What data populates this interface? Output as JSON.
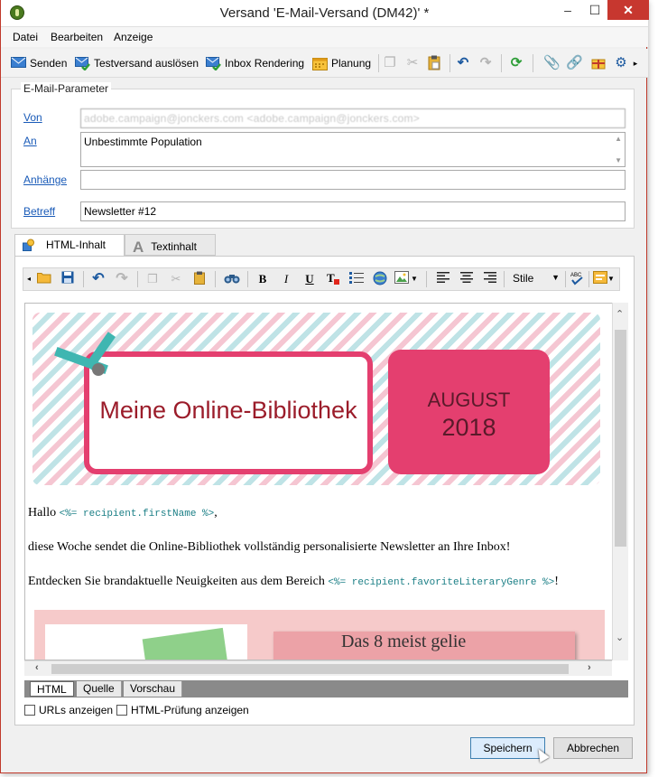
{
  "window": {
    "title": "Versand 'E-Mail-Versand (DM42)' *",
    "min": "–",
    "max": "☐",
    "close": "✕"
  },
  "menu": [
    "Datei",
    "Bearbeiten",
    "Anzeige"
  ],
  "toolbar": {
    "send": "Senden",
    "test_send": "Testversand auslösen",
    "inbox_rendering": "Inbox Rendering",
    "planning": "Planung"
  },
  "params": {
    "legend": "E-Mail-Parameter",
    "from_label": "Von",
    "from_value": "adobe.campaign@jonckers.com <adobe.campaign@jonckers.com>",
    "to_label": "An",
    "to_value": "Unbestimmte Population",
    "attachments_label": "Anhänge",
    "attachments_value": "",
    "subject_label": "Betreff",
    "subject_value": "Newsletter #12"
  },
  "tabs": {
    "html": "HTML-Inhalt",
    "text": "Textinhalt"
  },
  "editor": {
    "styles_label": "Stile",
    "bold": "B",
    "italic": "I",
    "underline": "U"
  },
  "newsletter": {
    "banner_title": "Meine Online-Bibliothek",
    "month": "AUGUST",
    "year": "2018",
    "greeting_prefix": "Hallo ",
    "greeting_code": "<%= recipient.firstName %>",
    "greeting_suffix": ",",
    "line2": "diese Woche sendet die Online-Bibliothek vollständig personalisierte Newsletter an Ihre Inbox!",
    "line3_prefix": "Entdecken Sie brandaktuelle Neuigkeiten aus dem Bereich ",
    "line3_code": "<%= recipient.favoriteLiteraryGenre %>",
    "line3_suffix": "!",
    "promo_text": "Das 8 meist gelie"
  },
  "bottom_tabs": [
    "HTML",
    "Quelle",
    "Vorschau"
  ],
  "options": {
    "show_urls": "URLs anzeigen",
    "show_html_check": "HTML-Prüfung anzeigen"
  },
  "buttons": {
    "save": "Speichern",
    "cancel": "Abbrechen"
  }
}
